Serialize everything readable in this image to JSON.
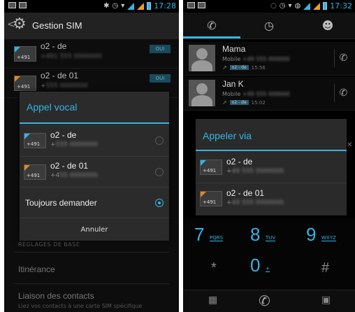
{
  "colors": {
    "accent": "#33b5e5",
    "warn_sim": "#e08a20",
    "dialog_bg": "#2b2b2b",
    "screen_bg": "#000000"
  },
  "left": {
    "status_time": "17:28",
    "actionbar": {
      "back_glyph": "<",
      "title": "Gestion SIM",
      "icon": "gear-icon"
    },
    "sim_rows": [
      {
        "name": "o2 - de",
        "number_prefix": "+491",
        "toggle": "OUI"
      },
      {
        "name": "o2 - de 01",
        "number_prefix": "+",
        "toggle": "OUI"
      }
    ],
    "dialog": {
      "title": "Appel vocal",
      "options": [
        {
          "name": "o2 - de",
          "card_prefix": "+491",
          "number_prefix": "+",
          "selected": false
        },
        {
          "name": "o2 - de 01",
          "card_prefix": "+491",
          "number_prefix": "+4",
          "selected": false
        }
      ],
      "always_ask": "Toujours demander",
      "always_selected": true,
      "cancel": "Annuler"
    },
    "section_header": "RÉGLAGES DE BASE",
    "items": [
      {
        "label": "Itinérance"
      },
      {
        "label": "Liaison des contacts",
        "sub": "Liez vos contacts à une carte SIM spécifique"
      }
    ]
  },
  "right": {
    "status_time": "17:32",
    "tabs": [
      "phone-icon",
      "clock-icon",
      "person-icon"
    ],
    "contacts": [
      {
        "name": "Mama",
        "type": "Mobile",
        "tag": "o2 - de",
        "time": "15:56"
      },
      {
        "name": "Jan K",
        "type": "Mobile",
        "tag": "o2 - de",
        "time": "15:02"
      }
    ],
    "dialog": {
      "title": "Appeler via",
      "options": [
        {
          "name": "o2 - de",
          "card_prefix": "+491",
          "number_prefix": "+"
        },
        {
          "name": "o2 - de 01",
          "card_prefix": "+491",
          "number_prefix": "+"
        }
      ]
    },
    "keys": [
      {
        "num": "7",
        "letters": "PQRS"
      },
      {
        "num": "8",
        "letters": "TUV"
      },
      {
        "num": "9",
        "letters": "WXYZ"
      },
      {
        "num": "*",
        "letters": ""
      },
      {
        "num": "0",
        "letters": "+"
      },
      {
        "num": "#",
        "letters": ""
      }
    ]
  }
}
